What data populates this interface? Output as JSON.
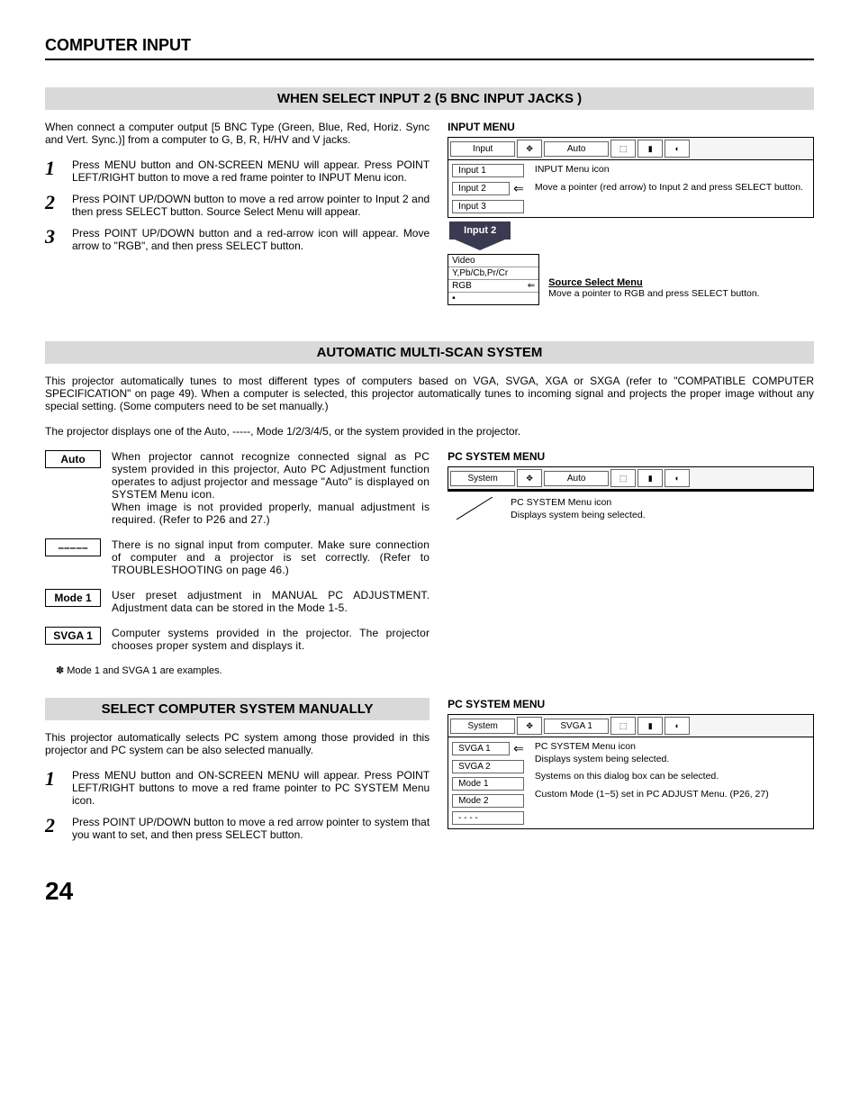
{
  "page_title": "COMPUTER INPUT",
  "page_number": "24",
  "section1": {
    "heading": "WHEN SELECT INPUT 2 (5 BNC INPUT JACKS )",
    "intro": "When connect a computer output [5 BNC Type (Green, Blue, Red, Horiz. Sync and Vert. Sync.)] from a computer to G, B, R, H/HV and V jacks.",
    "steps": [
      "Press MENU button and ON-SCREEN MENU will appear.  Press POINT LEFT/RIGHT button to move a red frame pointer to INPUT Menu icon.",
      "Press POINT UP/DOWN button to move a red arrow pointer to Input 2 and then press SELECT button.  Source Select Menu will appear.",
      "Press POINT UP/DOWN button and a red-arrow icon will appear.  Move arrow to \"RGB\", and then press SELECT button."
    ],
    "menu_label": "INPUT MENU",
    "menu": {
      "top_left": "Input",
      "top_right": "Auto",
      "items": [
        "Input 1",
        "Input 2",
        "Input 3"
      ],
      "note_title": "INPUT Menu icon",
      "note_text": "Move a pointer (red arrow) to Input 2 and press SELECT button.",
      "arrow_label": "Input 2",
      "source_items": [
        "Video",
        "Y,Pb/Cb,Pr/Cr",
        "RGB"
      ],
      "source_title": "Source Select Menu",
      "source_note": "Move a pointer to RGB and press SELECT button."
    }
  },
  "section2": {
    "heading": "AUTOMATIC MULTI-SCAN SYSTEM",
    "para1": "This projector automatically tunes to most different types of computers based on VGA, SVGA, XGA or SXGA (refer to \"COMPATIBLE COMPUTER SPECIFICATION\" on page 49).  When a computer is selected, this projector automatically tunes to incoming signal and projects the proper image without any special setting.  (Some computers need to be set manually.)",
    "para2": "The projector displays one of the Auto, -----, Mode 1/2/3/4/5, or the system provided in the projector.",
    "modes": [
      {
        "label": "Auto",
        "text": "When projector cannot recognize connected signal as PC system provided in this projector, Auto PC Adjustment function operates to adjust projector and message \"Auto\" is displayed on SYSTEM Menu icon.\nWhen image is not provided properly, manual adjustment is required.  (Refer to P26 and 27.)"
      },
      {
        "label": "–––––",
        "text": "There is no signal input from computer.  Make sure connection of computer and a projector is set correctly.  (Refer to TROUBLESHOOTING on page 46.)"
      },
      {
        "label": "Mode 1",
        "text": "User preset adjustment in MANUAL PC ADJUSTMENT.  Adjustment data can be stored in the Mode 1-5."
      },
      {
        "label": "SVGA 1",
        "text": "Computer systems provided in the projector. The projector chooses proper system and displays it."
      }
    ],
    "footnote": "✽  Mode 1 and SVGA 1 are examples.",
    "pc_menu_label": "PC SYSTEM MENU",
    "pc_menu": {
      "left": "System",
      "right": "Auto",
      "note": "PC SYSTEM Menu icon\nDisplays system being selected."
    }
  },
  "section3": {
    "heading": "SELECT COMPUTER SYSTEM MANUALLY",
    "intro": "This projector automatically selects PC system among those provided in this projector and PC system can be also selected manually.",
    "steps": [
      "Press MENU button and ON-SCREEN MENU will appear.  Press POINT LEFT/RIGHT buttons to move a red frame pointer to PC SYSTEM Menu icon.",
      "Press POINT UP/DOWN button to move a red arrow pointer to system that you want to set, and then press SELECT button."
    ],
    "pc_menu_label": "PC SYSTEM MENU",
    "pc_menu": {
      "left": "System",
      "right": "SVGA 1",
      "items": [
        "SVGA 1",
        "SVGA 2",
        "Mode 1",
        "Mode 2",
        "- - - -"
      ],
      "notes": [
        "PC SYSTEM Menu icon\nDisplays system being selected.",
        "Systems on this dialog box can be selected.",
        "Custom Mode (1~5) set in PC ADJUST Menu.  (P26, 27)"
      ]
    }
  }
}
